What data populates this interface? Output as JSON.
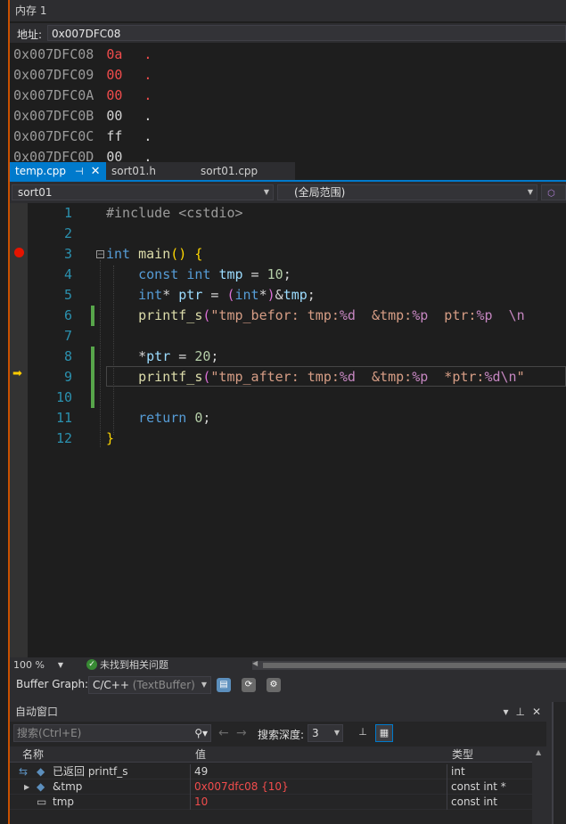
{
  "memory": {
    "title": "内存 1",
    "address_label": "地址:",
    "address_value": "0x007DFC08",
    "rows": [
      {
        "addr": "0x007DFC08",
        "val": "0a",
        "chr": ".",
        "changed": true
      },
      {
        "addr": "0x007DFC09",
        "val": "00",
        "chr": ".",
        "changed": true
      },
      {
        "addr": "0x007DFC0A",
        "val": "00",
        "chr": ".",
        "changed": true
      },
      {
        "addr": "0x007DFC0B",
        "val": "00",
        "chr": ".",
        "changed": false
      },
      {
        "addr": "0x007DFC0C",
        "val": "ff",
        "chr": ".",
        "changed": false
      },
      {
        "addr": "0x007DFC0D",
        "val": "00",
        "chr": ".",
        "changed": false
      }
    ]
  },
  "tabs": [
    {
      "label": "temp.cpp",
      "active": true
    },
    {
      "label": "sort01.h",
      "active": false
    },
    {
      "label": "sort01.cpp",
      "active": false
    }
  ],
  "navbar": {
    "project": "sort01",
    "scope": "(全局范围)",
    "member": "m"
  },
  "editor": {
    "line_numbers": [
      "1",
      "2",
      "3",
      "4",
      "5",
      "6",
      "7",
      "8",
      "9",
      "10",
      "11",
      "12"
    ],
    "lines": [
      [
        {
          "t": "#include <cstdio>",
          "c": "pp"
        }
      ],
      [],
      [
        {
          "t": "int",
          "c": "kw"
        },
        {
          "t": " "
        },
        {
          "t": "main",
          "c": "fn"
        },
        {
          "t": "() ",
          "c": "br"
        },
        {
          "t": "{",
          "c": "br"
        }
      ],
      [
        {
          "t": "    "
        },
        {
          "t": "const",
          "c": "kw"
        },
        {
          "t": " "
        },
        {
          "t": "int",
          "c": "kw"
        },
        {
          "t": " "
        },
        {
          "t": "tmp",
          "c": "id"
        },
        {
          "t": " = "
        },
        {
          "t": "10",
          "c": "num"
        },
        {
          "t": ";"
        }
      ],
      [
        {
          "t": "    "
        },
        {
          "t": "int",
          "c": "kw"
        },
        {
          "t": "* "
        },
        {
          "t": "ptr",
          "c": "id"
        },
        {
          "t": " = "
        },
        {
          "t": "(",
          "c": "br2"
        },
        {
          "t": "int",
          "c": "kw"
        },
        {
          "t": "*"
        },
        {
          "t": ")",
          "c": "br2"
        },
        {
          "t": "&"
        },
        {
          "t": "tmp",
          "c": "id"
        },
        {
          "t": ";"
        }
      ],
      [
        {
          "t": "    "
        },
        {
          "t": "printf_s",
          "c": "fn"
        },
        {
          "t": "(",
          "c": "br2"
        },
        {
          "t": "\"tmp_befor: tmp:",
          "c": "str"
        },
        {
          "t": "%d",
          "c": "fmt"
        },
        {
          "t": "  &tmp:",
          "c": "str"
        },
        {
          "t": "%p",
          "c": "fmt"
        },
        {
          "t": "  ptr:",
          "c": "str"
        },
        {
          "t": "%p",
          "c": "fmt"
        },
        {
          "t": "  ",
          "c": "str"
        },
        {
          "t": "\\n",
          "c": "fmt"
        }
      ],
      [],
      [
        {
          "t": "    *"
        },
        {
          "t": "ptr",
          "c": "id"
        },
        {
          "t": " = "
        },
        {
          "t": "20",
          "c": "num"
        },
        {
          "t": ";"
        }
      ],
      [
        {
          "t": "    "
        },
        {
          "t": "printf_s",
          "c": "fn"
        },
        {
          "t": "(",
          "c": "br2"
        },
        {
          "t": "\"tmp_after: tmp:",
          "c": "str"
        },
        {
          "t": "%d",
          "c": "fmt"
        },
        {
          "t": "  &tmp:",
          "c": "str"
        },
        {
          "t": "%p",
          "c": "fmt"
        },
        {
          "t": "  *ptr:",
          "c": "str"
        },
        {
          "t": "%d",
          "c": "fmt"
        },
        {
          "t": "\\n",
          "c": "fmt"
        },
        {
          "t": "\"",
          "c": "str"
        }
      ],
      [],
      [
        {
          "t": "    "
        },
        {
          "t": "return",
          "c": "kw"
        },
        {
          "t": " "
        },
        {
          "t": "0",
          "c": "num"
        },
        {
          "t": ";"
        }
      ],
      [
        {
          "t": "}",
          "c": "br"
        }
      ]
    ]
  },
  "status": {
    "zoom": "100 %",
    "issues": "未找到相关问题"
  },
  "buffer_graph": {
    "label": "Buffer Graph:",
    "value": "C/C++",
    "hint": "(TextBuffer)"
  },
  "autos": {
    "title": "自动窗口",
    "search_placeholder": "搜索(Ctrl+E)",
    "depth_label": "搜索深度:",
    "depth_value": "3",
    "columns": [
      "名称",
      "值",
      "类型"
    ],
    "rows": [
      {
        "name": "已返回 printf_s",
        "value": "49",
        "type": "int",
        "value_changed": false
      },
      {
        "name": "&tmp",
        "value": "0x007dfc08 {10}",
        "type": "const int *",
        "value_changed": true
      },
      {
        "name": "tmp",
        "value": "10",
        "type": "const int",
        "value_changed": true
      }
    ]
  },
  "colors": {
    "accent": "#007acc",
    "breakpoint": "#e51400",
    "instruction_pointer": "#ffcc00",
    "changed_value": "#f14c4c"
  }
}
